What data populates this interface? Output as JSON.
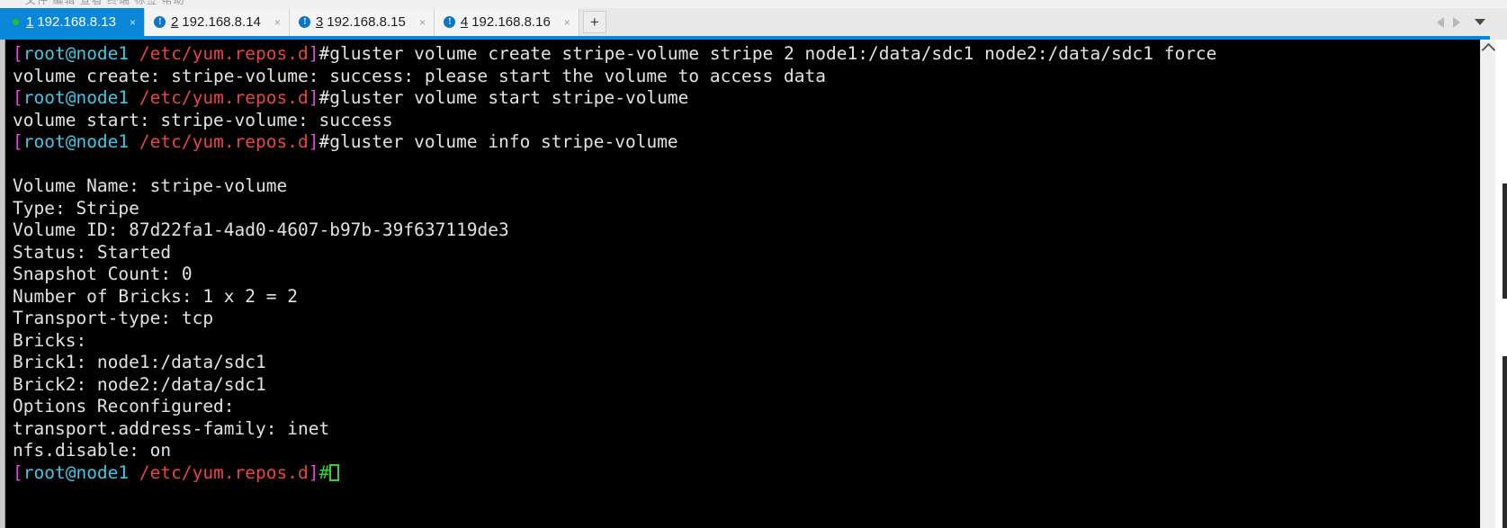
{
  "window": {
    "menu_remnant_text": "文件 编辑 查看 终端 标签 帮助"
  },
  "tabstrip": {
    "tabs": [
      {
        "number": "1",
        "label": "192.168.8.13",
        "status_icon": "green-dot-icon",
        "active": true,
        "close_label": "×"
      },
      {
        "number": "2",
        "label": "192.168.8.14",
        "status_icon": "info-icon",
        "active": false,
        "close_label": "×"
      },
      {
        "number": "3",
        "label": "192.168.8.15",
        "status_icon": "info-icon",
        "active": false,
        "close_label": "×"
      },
      {
        "number": "4",
        "label": "192.168.8.16",
        "status_icon": "info-icon",
        "active": false,
        "close_label": "×"
      }
    ],
    "new_tab_label": "+",
    "info_icon_glyph": "!",
    "nav": {
      "prev_icon": "chevron-left-icon",
      "next_icon": "chevron-right-icon",
      "list_icon": "chevron-down-icon"
    }
  },
  "colors": {
    "accent": "#0b87da",
    "tab_active_bg": "#0b87da",
    "terminal_bg": "#000000",
    "prompt_bracket": "#e249e2",
    "prompt_user": "#3bc9e8",
    "prompt_path": "#e84444",
    "cursor": "#35d135",
    "status_ok": "#21c21f",
    "status_info": "#0b76c8"
  },
  "terminal": {
    "prompt": {
      "open_bracket": "[",
      "user_host": "root@node1",
      "space": " ",
      "path": "/etc/yum.repos.d",
      "close_bracket": "]",
      "hash": "#"
    },
    "lines": [
      {
        "type": "prompt",
        "command": "gluster volume create stripe-volume stripe 2 node1:/data/sdc1 node2:/data/sdc1 force"
      },
      {
        "type": "output",
        "text": "volume create: stripe-volume: success: please start the volume to access data"
      },
      {
        "type": "prompt",
        "command": "gluster volume start stripe-volume"
      },
      {
        "type": "output",
        "text": "volume start: stripe-volume: success"
      },
      {
        "type": "prompt",
        "command": "gluster volume info stripe-volume"
      },
      {
        "type": "output",
        "text": ""
      },
      {
        "type": "output",
        "text": "Volume Name: stripe-volume"
      },
      {
        "type": "output",
        "text": "Type: Stripe"
      },
      {
        "type": "output",
        "text": "Volume ID: 87d22fa1-4ad0-4607-b97b-39f637119de3"
      },
      {
        "type": "output",
        "text": "Status: Started"
      },
      {
        "type": "output",
        "text": "Snapshot Count: 0"
      },
      {
        "type": "output",
        "text": "Number of Bricks: 1 x 2 = 2"
      },
      {
        "type": "output",
        "text": "Transport-type: tcp"
      },
      {
        "type": "output",
        "text": "Bricks:"
      },
      {
        "type": "output",
        "text": "Brick1: node1:/data/sdc1"
      },
      {
        "type": "output",
        "text": "Brick2: node2:/data/sdc1"
      },
      {
        "type": "output",
        "text": "Options Reconfigured:"
      },
      {
        "type": "output",
        "text": "transport.address-family: inet"
      },
      {
        "type": "output",
        "text": "nfs.disable: on"
      },
      {
        "type": "cursor",
        "command": ""
      }
    ]
  },
  "scrollbar": {
    "up_icon": "chevron-up-icon"
  }
}
